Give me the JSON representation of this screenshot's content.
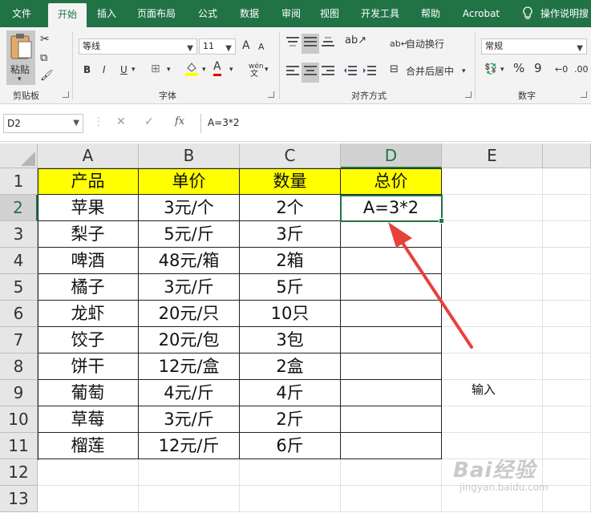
{
  "ribbon_tabs": [
    {
      "label": "文件"
    },
    {
      "label": "开始"
    },
    {
      "label": "插入"
    },
    {
      "label": "页面布局"
    },
    {
      "label": "公式"
    },
    {
      "label": "数据"
    },
    {
      "label": "审阅"
    },
    {
      "label": "视图"
    },
    {
      "label": "开发工具"
    },
    {
      "label": "帮助"
    },
    {
      "label": "Acrobat"
    },
    {
      "label": "操作说明搜"
    }
  ],
  "active_tab": "开始",
  "clipboard": {
    "paste_label": "粘贴",
    "group_label": "剪贴板"
  },
  "font": {
    "name": "等线",
    "size": "11",
    "group_label": "字体",
    "bold": "B",
    "italic": "I",
    "underline": "U",
    "grow": "A",
    "shrink": "A",
    "font_color": "A",
    "pinyin": "wén"
  },
  "alignment": {
    "wrap_label": "自动换行",
    "merge_label": "合并后居中",
    "group_label": "对齐方式"
  },
  "number": {
    "format": "常规",
    "percent": "%",
    "comma": "9",
    "group_label": "数字"
  },
  "formula_bar": {
    "name_box": "D2",
    "formula": "A=3*2",
    "fx": "fx"
  },
  "columns": [
    "A",
    "B",
    "C",
    "D",
    "E"
  ],
  "rows": [
    "1",
    "2",
    "3",
    "4",
    "5",
    "6",
    "7",
    "8",
    "9",
    "10",
    "11",
    "12",
    "13"
  ],
  "table": {
    "headers": [
      "产品",
      "单价",
      "数量",
      "总价"
    ],
    "rows": [
      [
        "苹果",
        "3元/个",
        "2个",
        "A=3*2"
      ],
      [
        "梨子",
        "5元/斤",
        "3斤",
        ""
      ],
      [
        "啤酒",
        "48元/箱",
        "2箱",
        ""
      ],
      [
        "橘子",
        "3元/斤",
        "5斤",
        ""
      ],
      [
        "龙虾",
        "20元/只",
        "10只",
        ""
      ],
      [
        "饺子",
        "20元/包",
        "3包",
        ""
      ],
      [
        "饼干",
        "12元/盒",
        "2盒",
        ""
      ],
      [
        "葡萄",
        "4元/斤",
        "4斤",
        ""
      ],
      [
        "草莓",
        "3元/斤",
        "2斤",
        ""
      ],
      [
        "榴莲",
        "12元/斤",
        "6斤",
        ""
      ]
    ]
  },
  "annotation": {
    "text": "输入",
    "arrow_color": "#e8413a"
  },
  "watermark": {
    "line1": "Bai经验",
    "line2": "jingyan.baidu.com"
  },
  "colors": {
    "excel_green": "#217346",
    "header_fill": "#ffff00"
  }
}
